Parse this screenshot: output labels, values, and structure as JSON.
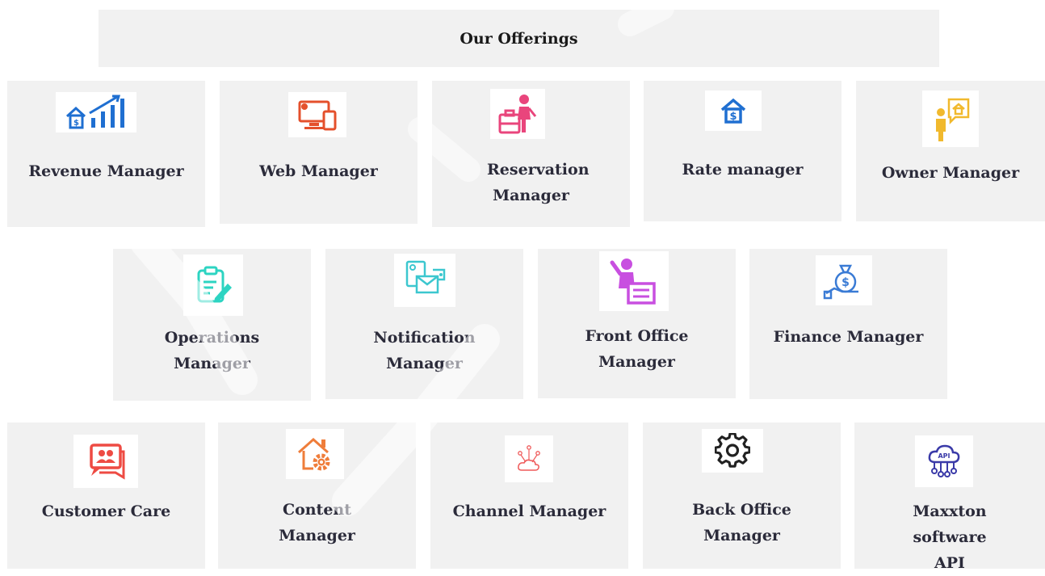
{
  "title": "Our Offerings",
  "offerings": [
    {
      "label": "Revenue Manager",
      "icon": "house-growth-chart-icon",
      "color": "#1f6fd1"
    },
    {
      "label": "Web Manager",
      "icon": "monitor-devices-icon",
      "color": "#e4502c"
    },
    {
      "label": "Reservation Manager",
      "icon": "traveler-luggage-icon",
      "color": "#e9457c"
    },
    {
      "label": "Rate manager",
      "icon": "house-dollar-icon",
      "color": "#1f6fd1"
    },
    {
      "label": "Owner Manager",
      "icon": "owner-house-bubble-icon",
      "color": "#f1b92d"
    },
    {
      "label": "Operations Manager",
      "icon": "clipboard-edit-icon",
      "color": "#2dd4c2"
    },
    {
      "label": "Notification Manager",
      "icon": "notification-mail-icon",
      "color": "#3cc7cf"
    },
    {
      "label": "Front Office Manager",
      "icon": "front-desk-person-icon",
      "color": "#c84fe0"
    },
    {
      "label": "Finance Manager",
      "icon": "money-bag-hand-icon",
      "color": "#3a7bd5"
    },
    {
      "label": "Customer Care",
      "icon": "chat-people-icon",
      "color": "#ee4b43"
    },
    {
      "label": "Content Manager",
      "icon": "house-gear-icon",
      "color": "#ef7d3a"
    },
    {
      "label": "Channel Manager",
      "icon": "cloud-network-icon",
      "color": "#ef5a5a"
    },
    {
      "label": "Back Office Manager",
      "icon": "gear-icon",
      "color": "#222222"
    },
    {
      "label": "Maxxton software API",
      "icon": "cloud-api-icon",
      "color": "#3a3aa8"
    }
  ],
  "api_badge": "API"
}
